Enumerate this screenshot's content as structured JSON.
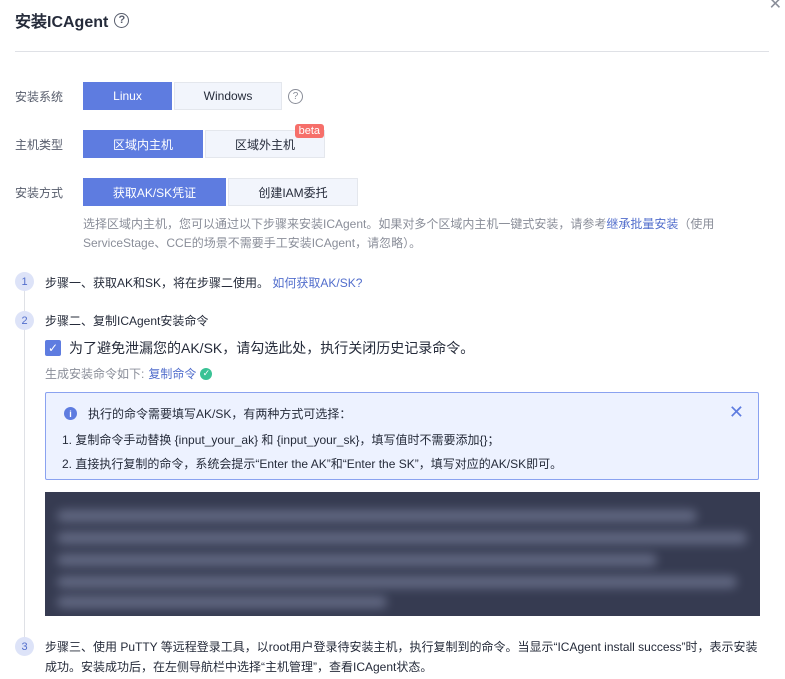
{
  "dialog": {
    "title": "安装ICAgent"
  },
  "install_system": {
    "label": "安装系统",
    "options": [
      "Linux",
      "Windows"
    ],
    "selected": "Linux"
  },
  "host_type": {
    "label": "主机类型",
    "options": [
      "区域内主机",
      "区域外主机"
    ],
    "selected": "区域内主机",
    "badge": "beta"
  },
  "install_method": {
    "label": "安装方式",
    "options": [
      "获取AK/SK凭证",
      "创建IAM委托"
    ],
    "selected": "获取AK/SK凭证"
  },
  "description": {
    "text_before": "选择区域内主机，您可以通过以下步骤来安装ICAgent。如果对多个区域内主机一键式安装，请参考",
    "link": "继承批量安装",
    "text_after": "（使用ServiceStage、CCE的场景不需要手工安装ICAgent，请忽略）。"
  },
  "steps": [
    {
      "number": "1",
      "text": "步骤一、获取AK和SK，将在步骤二使用。",
      "link": "如何获取AK/SK?"
    },
    {
      "number": "2",
      "text": "步骤二、复制ICAgent安装命令"
    },
    {
      "number": "3",
      "text": "步骤三、使用 PuTTY 等远程登录工具，以root用户登录待安装主机，执行复制到的命令。当显示“ICAgent install success”时，表示安装成功。安装成功后，在左侧导航栏中选择“主机管理”，查看ICAgent状态。"
    }
  ],
  "checkbox": {
    "label": "为了避免泄漏您的AK/SK，请勾选此处，执行关闭历史记录命令。",
    "checked": true
  },
  "generate": {
    "label": "生成安装命令如下:",
    "copy_link": "复制命令"
  },
  "info": {
    "title": "执行的命令需要填写AK/SK，有两种方式可选择：",
    "line1": "1. 复制命令手动替换 {input_your_ak} 和 {input_your_sk}，填写值时不需要添加{}；",
    "line2": "2. 直接执行复制的命令，系统会提示“Enter the AK”和“Enter the SK”，填写对应的AK/SK即可。"
  },
  "colors": {
    "primary": "#5e7ce0",
    "link": "#526ecc",
    "code_bg": "#363b51",
    "info_bg": "#edf2ff",
    "success": "#3ac295",
    "badge": "#f66f6a"
  }
}
